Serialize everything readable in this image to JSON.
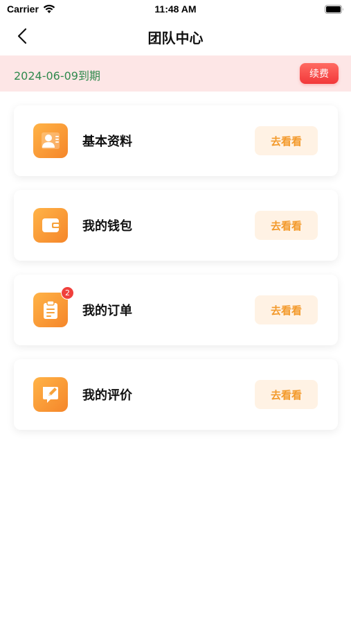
{
  "status_bar": {
    "carrier": "Carrier",
    "time": "11:48 AM"
  },
  "nav": {
    "title": "团队中心",
    "back_icon": "chevron-left-icon"
  },
  "banner": {
    "expiry_text": "2024-06-09到期",
    "renew_label": "续费"
  },
  "menu": [
    {
      "label": "基本资料",
      "icon": "profile-card-icon",
      "action": "去看看"
    },
    {
      "label": "我的钱包",
      "icon": "wallet-icon",
      "action": "去看看"
    },
    {
      "label": "我的订单",
      "icon": "clipboard-icon",
      "action": "去看看",
      "badge": "2"
    },
    {
      "label": "我的评价",
      "icon": "edit-comment-icon",
      "action": "去看看"
    }
  ],
  "colors": {
    "accent": "#f5862a",
    "danger": "#f2383a",
    "expiry_text": "#2f8a4d",
    "banner_bg": "#fde6e6"
  }
}
